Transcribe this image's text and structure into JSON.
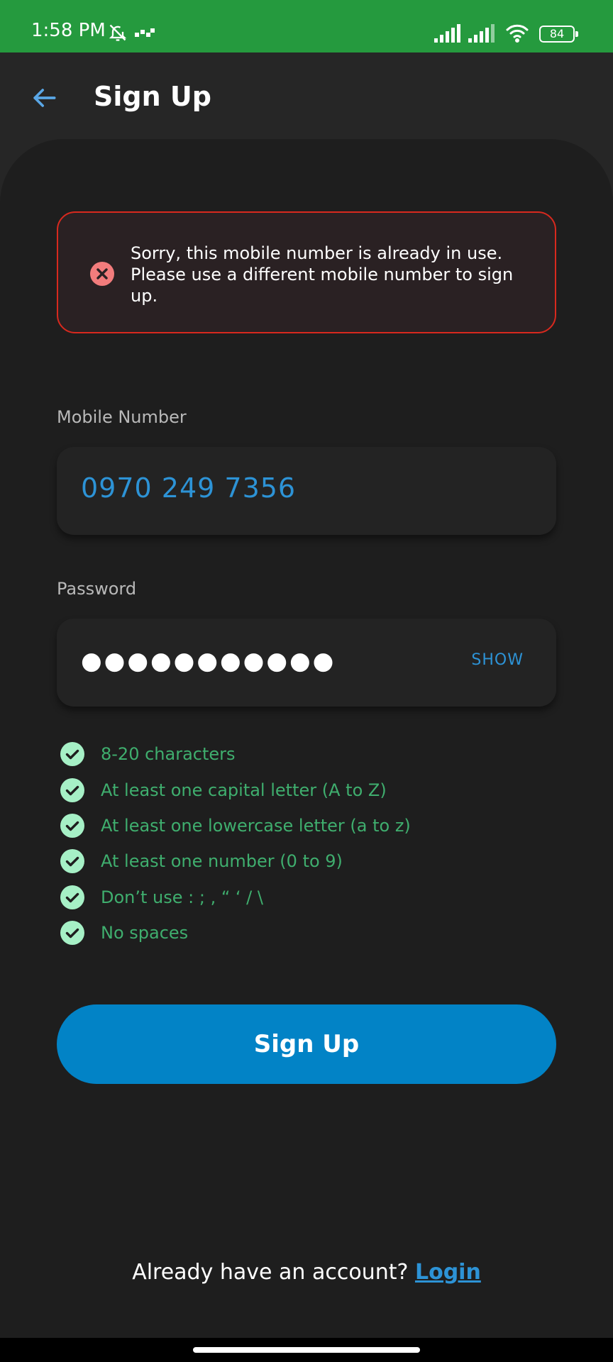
{
  "status_bar": {
    "time": "1:58 PM",
    "battery": "84"
  },
  "header": {
    "title": "Sign Up"
  },
  "error": {
    "message": "Sorry, this mobile number is already in use. Please use a different mobile number to sign up."
  },
  "mobile": {
    "label": "Mobile Number",
    "value": "0970 249 7356"
  },
  "password": {
    "label": "Password",
    "masked_value": "●●●●●●●●●●●",
    "show_label": "SHOW"
  },
  "rules": [
    {
      "text": "8-20 characters"
    },
    {
      "text": "At least one capital letter (A to Z)"
    },
    {
      "text": "At least one lowercase letter (a to z)"
    },
    {
      "text": "At least one number (0 to 9)"
    },
    {
      "text": "Don’t use : ; , “ ‘ / \\"
    },
    {
      "text": "No spaces"
    }
  ],
  "signup_button": {
    "label": "Sign Up"
  },
  "footer": {
    "prompt": "Already have an account?",
    "login_label": "Login"
  },
  "colors": {
    "status_bar": "#259a3e",
    "background": "#262626",
    "card": "#1e1e1e",
    "accent": "#0283c6",
    "error_border": "#d8291e",
    "success": "#3fae6e"
  }
}
